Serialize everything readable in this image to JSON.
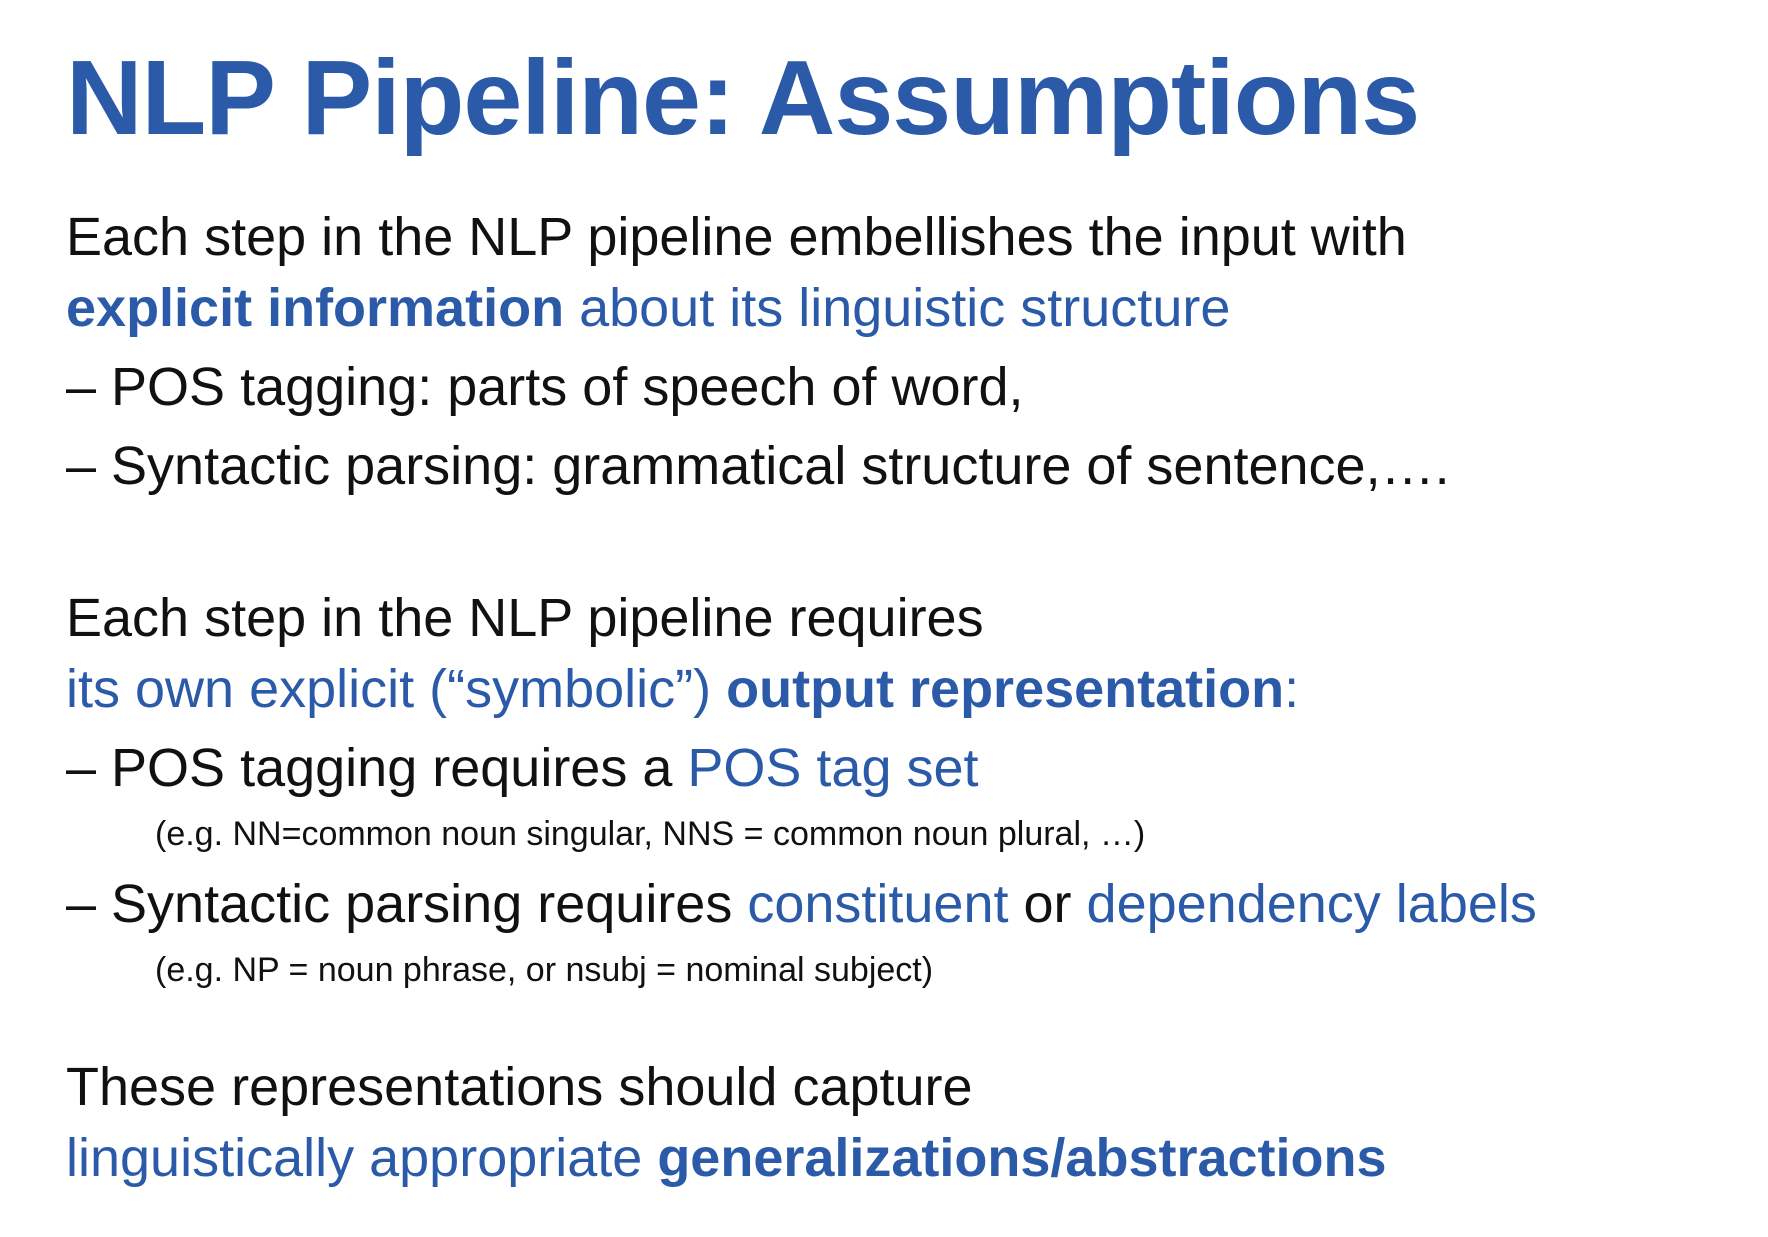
{
  "title": "NLP Pipeline: Assumptions",
  "section1": {
    "intro": "Each step in the NLP pipeline embellishes the input with",
    "emph_bold": "explicit information",
    "emph_rest": " about its linguistic structure",
    "bullet1": "– POS tagging: parts of speech of word,",
    "bullet2": "– Syntactic parsing: grammatical structure of sentence,…."
  },
  "section2": {
    "intro": "Each step in the NLP pipeline requires",
    "emph_plain": "its own explicit (“symbolic”) ",
    "emph_bold": "output representation",
    "emph_colon": ":",
    "bullet1_prefix": "– POS tagging requires a ",
    "bullet1_term": "POS tag set",
    "bullet1_note": "(e.g. NN=common noun singular, NNS = common noun plural, …)",
    "bullet2_prefix": "– Syntactic parsing requires ",
    "bullet2_term1": "constituent",
    "bullet2_or": " or ",
    "bullet2_term2": "dependency labels",
    "bullet2_note": "(e.g. NP = noun phrase, or nsubj = nominal subject)"
  },
  "section3": {
    "intro": "These representations should capture",
    "emph_plain": "linguistically appropriate ",
    "emph_bold": "generalizations/abstractions"
  },
  "colors": {
    "accent": "#2b5aa8",
    "text": "#111111",
    "background": "#ffffff"
  }
}
